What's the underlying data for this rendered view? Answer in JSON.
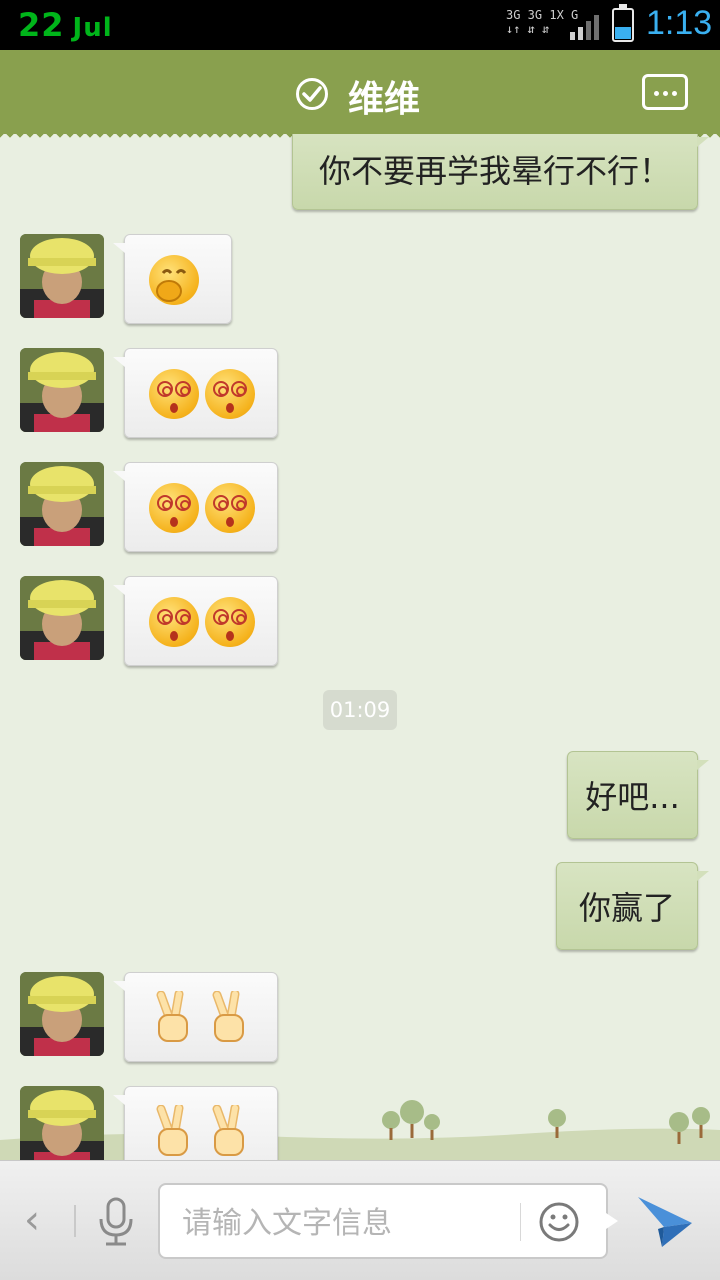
{
  "status_bar": {
    "day": "22",
    "month": "Jul",
    "network_line1": "3G 3G 1X G",
    "network_line2": "↓↑ ⇵ ⇵",
    "time": "1:13",
    "battery_level": 0.4
  },
  "header": {
    "title": "维维"
  },
  "messages": [
    {
      "side": "right",
      "text": "你不要再学我晕行不行！"
    },
    {
      "side": "left",
      "emoji": [
        "grin"
      ]
    },
    {
      "side": "left",
      "emoji": [
        "dizzy",
        "dizzy"
      ]
    },
    {
      "side": "left",
      "emoji": [
        "dizzy",
        "dizzy"
      ]
    },
    {
      "side": "left",
      "emoji": [
        "dizzy",
        "dizzy"
      ]
    },
    {
      "side": "time",
      "text": "01:09"
    },
    {
      "side": "right",
      "text": "好吧..."
    },
    {
      "side": "right",
      "text": "你赢了"
    },
    {
      "side": "left",
      "emoji": [
        "peace",
        "peace"
      ]
    },
    {
      "side": "left",
      "emoji": [
        "peace",
        "peace"
      ]
    }
  ],
  "m": {
    "msg1": "你不要再学我晕行不行！",
    "time": "01:09",
    "msg2": "好吧...",
    "msg3": "你赢了"
  },
  "input": {
    "placeholder": "请输入文字信息",
    "value": ""
  },
  "icons": {
    "back": "chevron-left-icon",
    "mic": "microphone-icon",
    "emoji": "smiley-icon",
    "send": "paper-plane-icon"
  },
  "colors": {
    "header_bg": "#89a04e",
    "chat_bg": "#e9efe1",
    "right_bubble": "#d3e0bb",
    "left_bubble": "#f6f6f6",
    "status_date": "#00b51a",
    "status_time": "#3ab0f0"
  }
}
